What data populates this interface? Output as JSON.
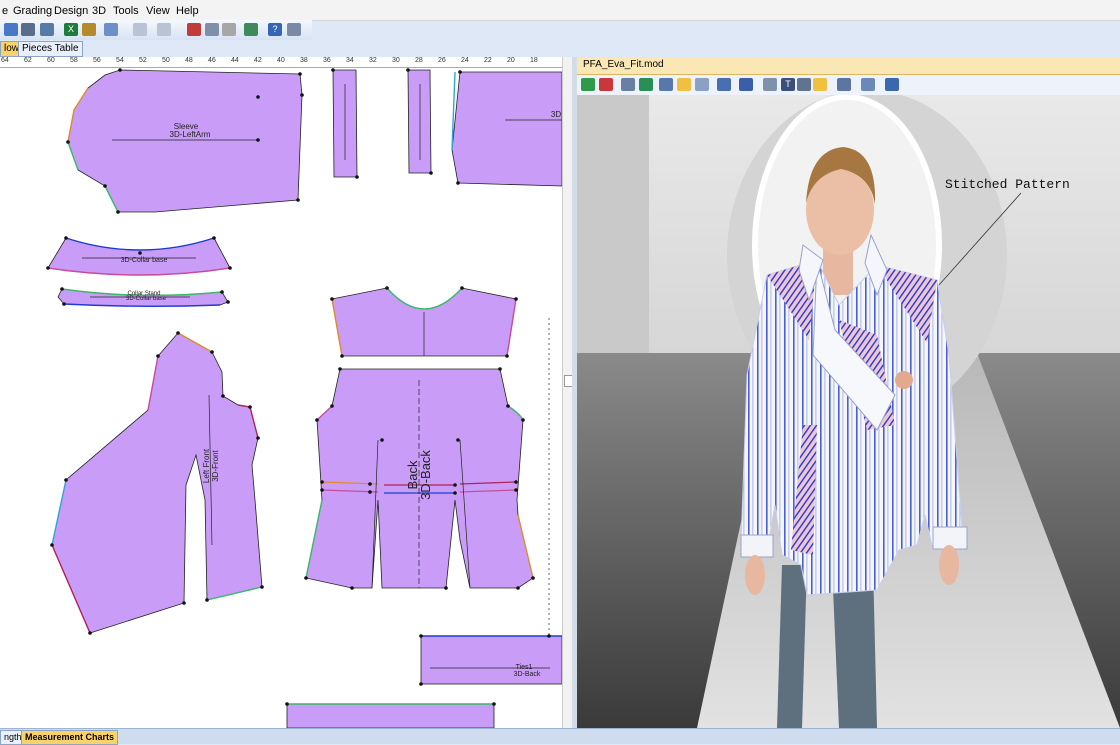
{
  "menu": [
    "e",
    "Grading",
    "Design",
    "3D",
    "Tools",
    "View",
    "Help"
  ],
  "tabs": {
    "window_tab": "low",
    "pieces_tab": "Pieces Table"
  },
  "ruler_ticks": [
    "64",
    "62",
    "60",
    "58",
    "56",
    "54",
    "52",
    "50",
    "48",
    "46",
    "44",
    "42",
    "40",
    "38",
    "36",
    "34",
    "32",
    "30",
    "28",
    "26",
    "24",
    "22",
    "20",
    "18"
  ],
  "pieces": {
    "sleeve": {
      "name": "Sleeve",
      "code": "3D-LeftArm"
    },
    "collar_base": {
      "code": "3D-Collar base"
    },
    "collar_stand": {
      "name": "Collar Stand",
      "code": "3D-Collar base"
    },
    "left_front": {
      "name": "Left Front",
      "code": "3D-Front"
    },
    "back": {
      "name": "Back",
      "code": "3D-Back"
    },
    "ties": {
      "name": "Ties1",
      "code": "3D-Back"
    },
    "partial_right": {
      "code": "3D"
    }
  },
  "viewer": {
    "file_title": "PFA_Eva_Fit.mod",
    "annotation": "Stitched Pattern"
  },
  "bottom_tabs": [
    "ngth",
    "Measurement Charts"
  ],
  "colors": {
    "piece_fill": "#c99df7",
    "tab_active": "#f9d36a",
    "viewer_title_bg": "#fbe7b4",
    "stitch_blue": "#1f3bd6",
    "stitch_red": "#d2334a"
  }
}
